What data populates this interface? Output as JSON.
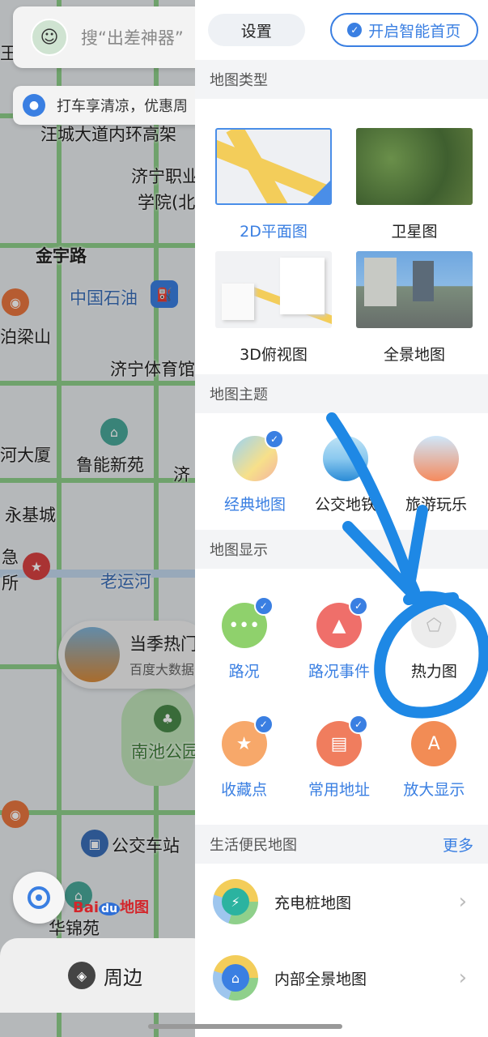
{
  "map": {
    "search_placeholder": "搜“出差神器”",
    "promo_text": "打车享清凉，优惠周",
    "labels": [
      {
        "text": "王",
        "cls": ""
      },
      {
        "text": "汪城大道内环高架",
        "cls": ""
      },
      {
        "text": "济宁职业",
        "cls": ""
      },
      {
        "text": "学院(北",
        "cls": ""
      },
      {
        "text": "金宇路",
        "cls": "bold"
      },
      {
        "text": "中国石油",
        "cls": "blue"
      },
      {
        "text": "泊梁山",
        "cls": ""
      },
      {
        "text": "济宁体育馆",
        "cls": ""
      },
      {
        "text": "河大厦",
        "cls": ""
      },
      {
        "text": "鲁能新苑",
        "cls": ""
      },
      {
        "text": "济",
        "cls": ""
      },
      {
        "text": "永基城",
        "cls": ""
      },
      {
        "text": "急",
        "cls": ""
      },
      {
        "text": "所",
        "cls": ""
      },
      {
        "text": "老运河",
        "cls": "blue"
      },
      {
        "text": "南池公园",
        "cls": "green"
      },
      {
        "text": "公交车站",
        "cls": ""
      },
      {
        "text": "华锦苑",
        "cls": ""
      }
    ],
    "poi_card": {
      "title": "当季热门",
      "subtitle": "百度大数据"
    },
    "logo_bai": "Bai",
    "logo_du": "du",
    "logo_suffix": "地图",
    "nearby_label": "周边"
  },
  "panel": {
    "settings_label": "设置",
    "smart_home_label": "开启智能首页",
    "section_map_type": "地图类型",
    "map_types": [
      {
        "label": "2D平面图",
        "selected": true
      },
      {
        "label": "卫星图",
        "selected": false
      },
      {
        "label": "3D俯视图",
        "selected": false
      },
      {
        "label": "全景地图",
        "selected": false
      }
    ],
    "section_map_theme": "地图主题",
    "themes": [
      {
        "label": "经典地图",
        "selected": true
      },
      {
        "label": "公交地铁",
        "selected": false
      },
      {
        "label": "旅游玩乐",
        "selected": false
      }
    ],
    "section_map_display": "地图显示",
    "display_items": [
      {
        "label": "路况",
        "selected": true,
        "icon": "traffic-icon"
      },
      {
        "label": "路况事件",
        "selected": true,
        "icon": "traffic-cone-icon"
      },
      {
        "label": "热力图",
        "selected": false,
        "icon": "heatmap-icon"
      },
      {
        "label": "收藏点",
        "selected": true,
        "icon": "star-icon"
      },
      {
        "label": "常用地址",
        "selected": true,
        "icon": "address-book-icon"
      },
      {
        "label": "放大显示",
        "selected": false,
        "icon": "enlarge-text-icon"
      }
    ],
    "section_life": "生活便民地图",
    "more_label": "更多",
    "life_items": [
      {
        "label": "充电桩地图"
      },
      {
        "label": "内部全景地图"
      }
    ]
  },
  "colors": {
    "accent": "#3a7fe2",
    "annotation": "#1e88e5"
  }
}
